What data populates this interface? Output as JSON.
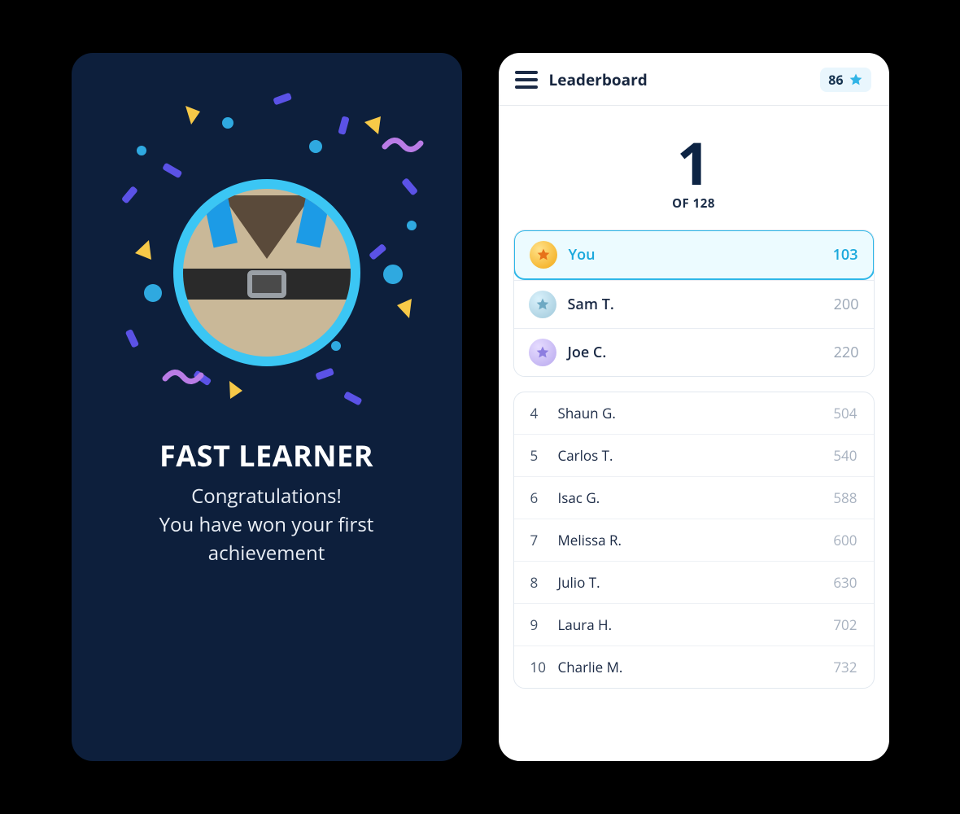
{
  "achievement": {
    "title": "FAST LEARNER",
    "line1": "Congratulations!",
    "line2": "You have won your first",
    "line3": "achievement"
  },
  "leaderboard": {
    "title": "Leaderboard",
    "points": "86",
    "rank_number": "1",
    "rank_total": "OF 128",
    "top3": [
      {
        "medal": "gold",
        "name": "You",
        "score": "103",
        "is_you": true
      },
      {
        "medal": "silver",
        "name": "Sam T.",
        "score": "200",
        "is_you": false
      },
      {
        "medal": "bronze",
        "name": "Joe C.",
        "score": "220",
        "is_you": false
      }
    ],
    "rest": [
      {
        "rank": "4",
        "name": "Shaun G.",
        "score": "504"
      },
      {
        "rank": "5",
        "name": "Carlos T.",
        "score": "540"
      },
      {
        "rank": "6",
        "name": "Isac G.",
        "score": "588"
      },
      {
        "rank": "7",
        "name": "Melissa R.",
        "score": "600"
      },
      {
        "rank": "8",
        "name": "Julio T.",
        "score": "630"
      },
      {
        "rank": "9",
        "name": "Laura H.",
        "score": "702"
      },
      {
        "rank": "10",
        "name": "Charlie M.",
        "score": "732"
      }
    ]
  }
}
